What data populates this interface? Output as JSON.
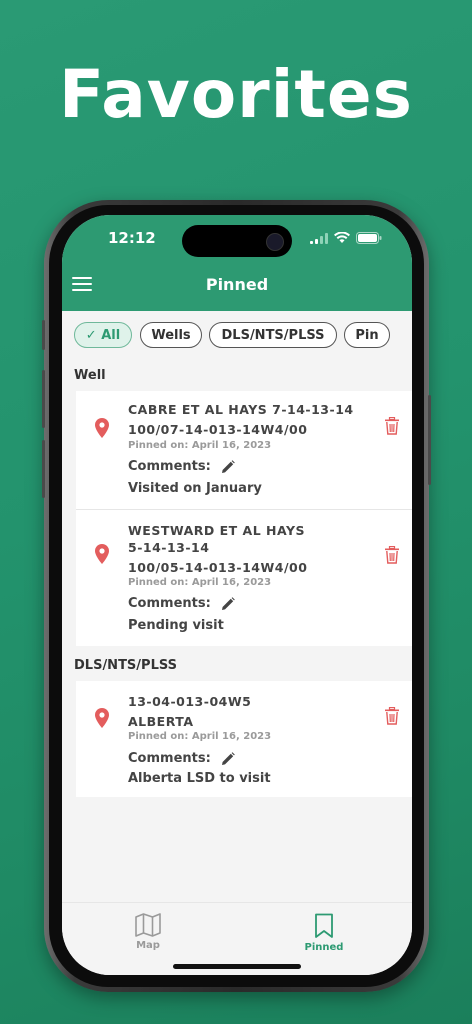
{
  "headline": "Favorites",
  "status_bar": {
    "time": "12:12"
  },
  "nav": {
    "title": "Pinned",
    "menu_icon": "hamburger-menu-icon"
  },
  "filters": [
    {
      "label": "All",
      "selected": true
    },
    {
      "label": "Wells",
      "selected": false
    },
    {
      "label": "DLS/NTS/PLSS",
      "selected": false
    },
    {
      "label": "Pin",
      "selected": false
    }
  ],
  "sections": [
    {
      "label": "Well",
      "items": [
        {
          "title_lines": [
            "CABRE ET AL HAYS 7-14-13-14",
            "100/07-14-013-14W4/00"
          ],
          "pinned_on": "Pinned on: April 16, 2023",
          "comments_label": "Comments:",
          "comment": "Visited on January"
        },
        {
          "title_lines": [
            "WESTWARD ET AL HAYS",
            "5-14-13-14",
            "100/05-14-013-14W4/00"
          ],
          "pinned_on": "Pinned on: April 16, 2023",
          "comments_label": "Comments:",
          "comment": "Pending visit"
        }
      ]
    },
    {
      "label": "DLS/NTS/PLSS",
      "items": [
        {
          "title_lines": [
            "13-04-013-04W5",
            "ALBERTA"
          ],
          "pinned_on": "Pinned on: April 16, 2023",
          "comments_label": "Comments:",
          "comment": "Alberta LSD to visit"
        }
      ]
    }
  ],
  "tabs": [
    {
      "label": "Map",
      "icon": "map-icon",
      "active": false
    },
    {
      "label": "Pinned",
      "icon": "bookmark-icon",
      "active": true
    }
  ],
  "colors": {
    "accent": "#2d9a72",
    "background": "#23936d",
    "danger": "#e35d5d",
    "pin": "#e35d5d"
  }
}
